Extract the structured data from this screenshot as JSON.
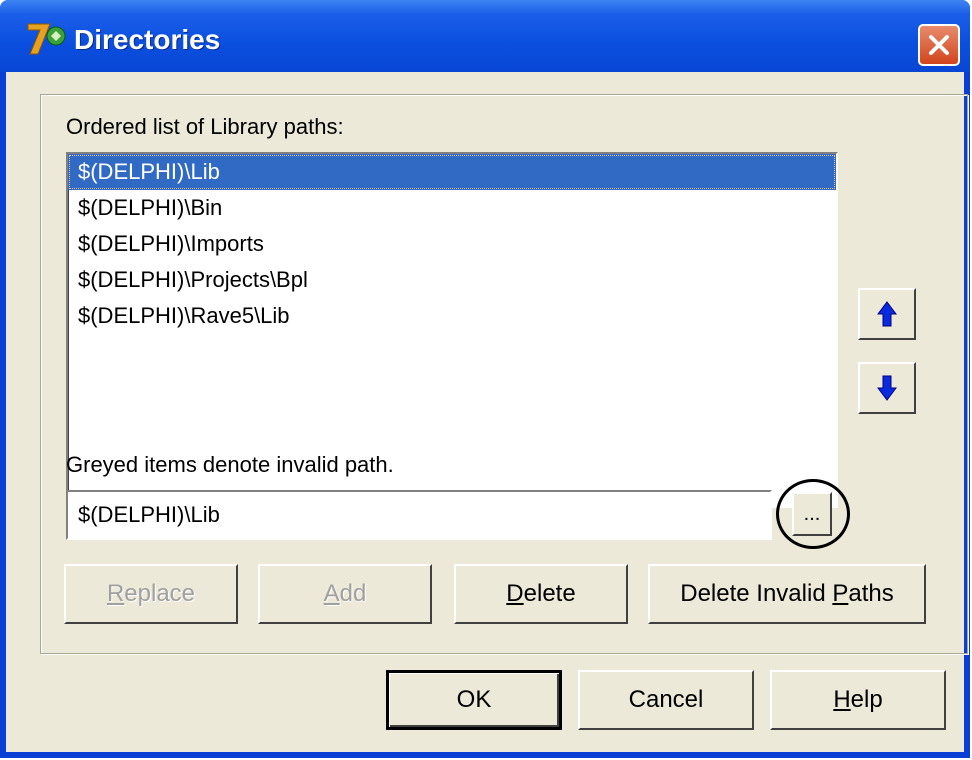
{
  "window": {
    "title": "Directories"
  },
  "library": {
    "label": "Ordered list of Library paths:",
    "items": [
      "$(DELPHI)\\Lib",
      "$(DELPHI)\\Bin",
      "$(DELPHI)\\Imports",
      "$(DELPHI)\\Projects\\Bpl",
      "$(DELPHI)\\Rave5\\Lib"
    ],
    "selected_index": 0
  },
  "hint": "Greyed items denote invalid path.",
  "path_input": {
    "value": "$(DELPHI)\\Lib",
    "browse_label": "..."
  },
  "actions": {
    "replace_prefix": "",
    "replace_accel": "R",
    "replace_rest": "eplace",
    "add_prefix": "",
    "add_accel": "A",
    "add_rest": "dd",
    "delete_prefix": "",
    "delete_accel": "D",
    "delete_rest": "elete",
    "delete_invalid_prefix": "Delete Invalid ",
    "delete_invalid_accel": "P",
    "delete_invalid_rest": "aths"
  },
  "dialog": {
    "ok": "OK",
    "cancel": "Cancel",
    "help_accel": "H",
    "help_rest": "elp"
  },
  "icons": {
    "up": "arrow-up-icon",
    "down": "arrow-down-icon",
    "close": "close-icon",
    "app": "delphi7-icon"
  },
  "colors": {
    "titlebar": "#0b4fe0",
    "selection": "#316ac5",
    "face": "#ece9d8",
    "close": "#d2451d"
  }
}
